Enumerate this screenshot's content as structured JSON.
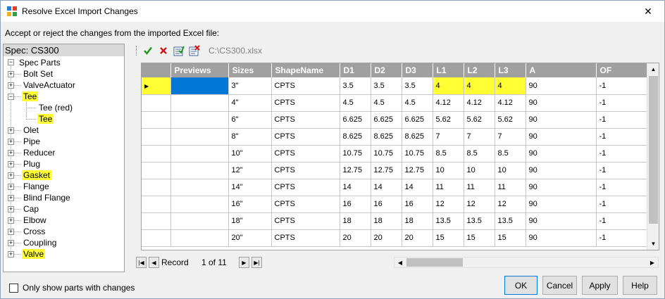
{
  "window": {
    "title": "Resolve Excel Import Changes",
    "close_glyph": "✕",
    "instructions": "Accept or reject the changes from the imported Excel file:"
  },
  "tree": {
    "header": "Spec: CS300",
    "root": "Spec Parts",
    "items": [
      {
        "label": "Bolt Set",
        "highlight": false
      },
      {
        "label": "ValveActuator",
        "highlight": false
      },
      {
        "label": "Tee",
        "highlight": true
      },
      {
        "label": "Tee (red)",
        "highlight": false
      },
      {
        "label": "Tee",
        "highlight": true
      },
      {
        "label": "Olet",
        "highlight": false
      },
      {
        "label": "Pipe",
        "highlight": false
      },
      {
        "label": "Reducer",
        "highlight": false
      },
      {
        "label": "Plug",
        "highlight": false
      },
      {
        "label": "Gasket",
        "highlight": true
      },
      {
        "label": "Flange",
        "highlight": false
      },
      {
        "label": "Blind Flange",
        "highlight": false
      },
      {
        "label": "Cap",
        "highlight": false
      },
      {
        "label": "Elbow",
        "highlight": false
      },
      {
        "label": "Cross",
        "highlight": false
      },
      {
        "label": "Coupling",
        "highlight": false
      },
      {
        "label": "Valve",
        "highlight": true
      }
    ]
  },
  "toolbar": {
    "file_path": "C:\\CS300.xlsx",
    "icons": [
      "accept-icon",
      "reject-icon",
      "accept-all-icon",
      "reject-all-icon"
    ]
  },
  "grid": {
    "columns": [
      "",
      "Previews",
      "Sizes",
      "ShapeName",
      "D1",
      "D2",
      "D3",
      "L1",
      "L2",
      "L3",
      "A",
      "OF"
    ],
    "rows": [
      [
        "",
        "",
        "3\"",
        "CPTS",
        "3.5",
        "3.5",
        "3.5",
        "4",
        "4",
        "4",
        "90",
        "-1"
      ],
      [
        "",
        "",
        "4\"",
        "CPTS",
        "4.5",
        "4.5",
        "4.5",
        "4.12",
        "4.12",
        "4.12",
        "90",
        "-1"
      ],
      [
        "",
        "",
        "6\"",
        "CPTS",
        "6.625",
        "6.625",
        "6.625",
        "5.62",
        "5.62",
        "5.62",
        "90",
        "-1"
      ],
      [
        "",
        "",
        "8\"",
        "CPTS",
        "8.625",
        "8.625",
        "8.625",
        "7",
        "7",
        "7",
        "90",
        "-1"
      ],
      [
        "",
        "",
        "10\"",
        "CPTS",
        "10.75",
        "10.75",
        "10.75",
        "8.5",
        "8.5",
        "8.5",
        "90",
        "-1"
      ],
      [
        "",
        "",
        "12\"",
        "CPTS",
        "12.75",
        "12.75",
        "12.75",
        "10",
        "10",
        "10",
        "90",
        "-1"
      ],
      [
        "",
        "",
        "14\"",
        "CPTS",
        "14",
        "14",
        "14",
        "11",
        "11",
        "11",
        "90",
        "-1"
      ],
      [
        "",
        "",
        "16\"",
        "CPTS",
        "16",
        "16",
        "16",
        "12",
        "12",
        "12",
        "90",
        "-1"
      ],
      [
        "",
        "",
        "18\"",
        "CPTS",
        "18",
        "18",
        "18",
        "13.5",
        "13.5",
        "13.5",
        "90",
        "-1"
      ],
      [
        "",
        "",
        "20\"",
        "CPTS",
        "20",
        "20",
        "20",
        "15",
        "15",
        "15",
        "90",
        "-1"
      ]
    ],
    "highlight_color": "#ffff33",
    "selection_color": "#0078d7"
  },
  "navigator": {
    "record_label": "Record",
    "position": "1 of 11"
  },
  "footer": {
    "checkbox_label": "Only show parts with changes",
    "ok": "OK",
    "cancel": "Cancel",
    "apply": "Apply",
    "help": "Help"
  }
}
